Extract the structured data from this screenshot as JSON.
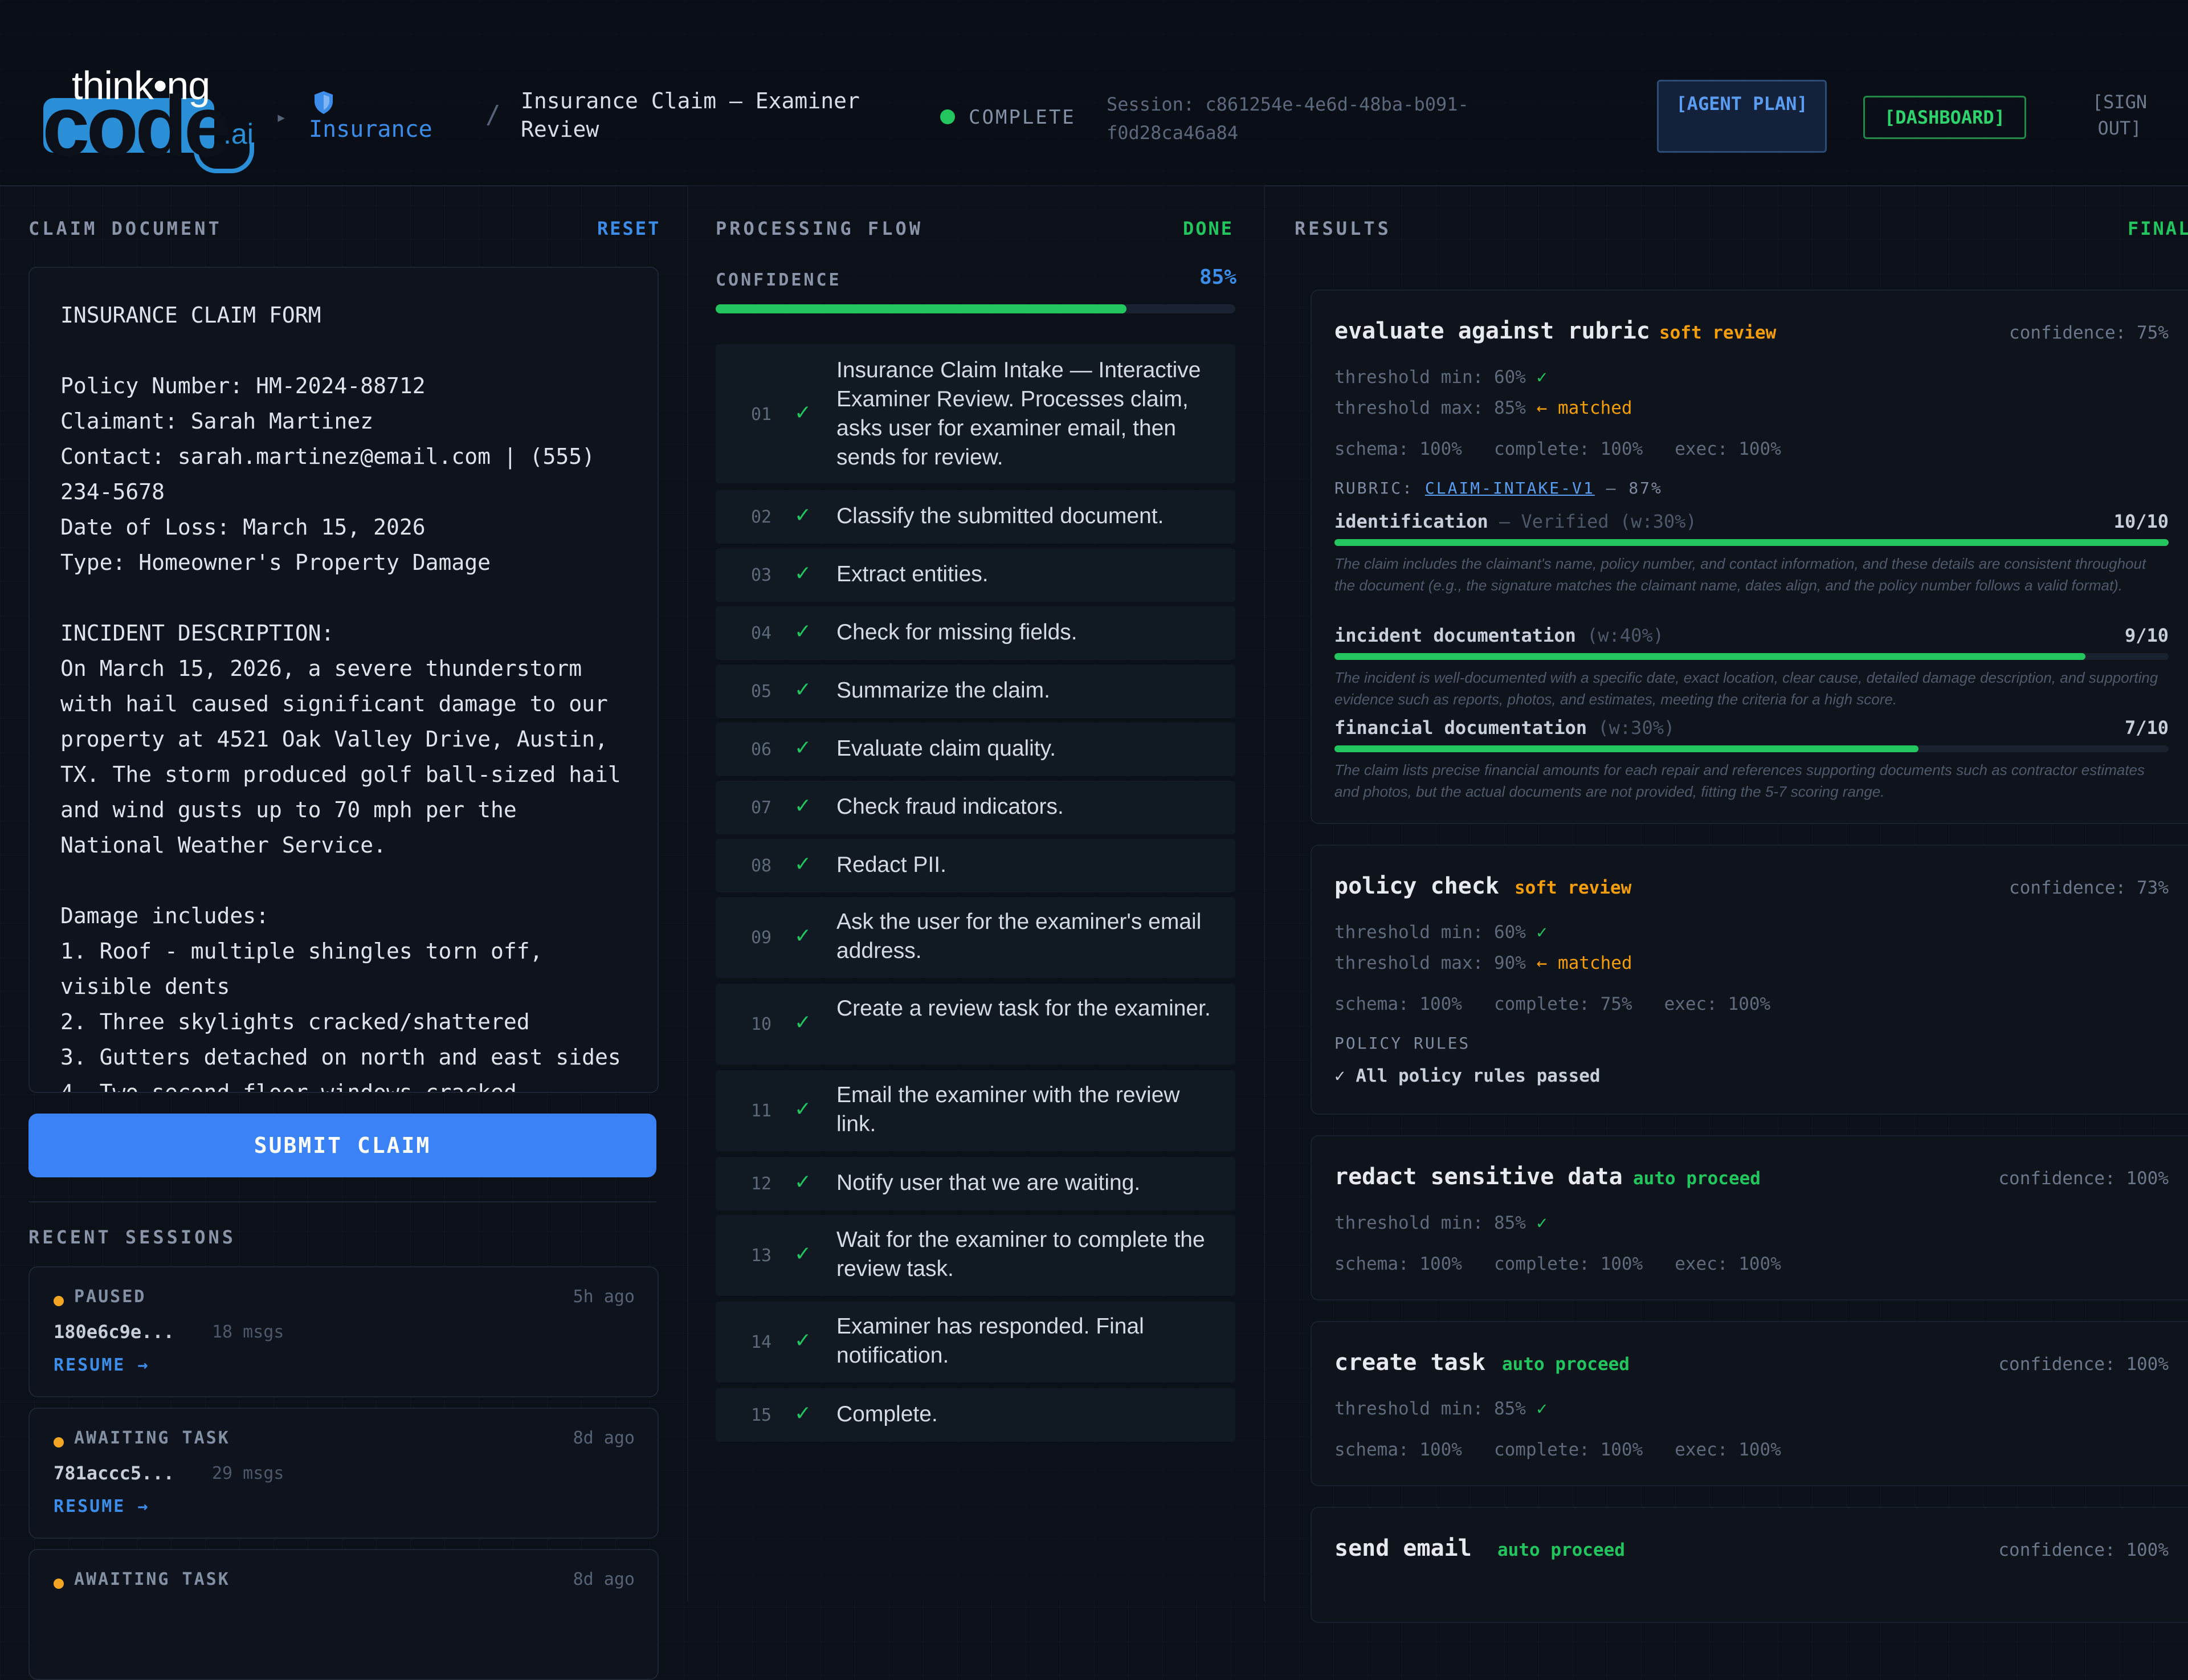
{
  "header": {
    "logo": {
      "line1": "think•ng",
      "line2": "code",
      "suffix": ".ai"
    },
    "breadcrumb_sep": "▸",
    "breadcrumb_section": "Insurance",
    "breadcrumb_divider": "/",
    "page_title": "Insurance Claim — Examiner Review",
    "status": "COMPLETE",
    "session": "Session: c861254e-4e6d-48ba-b091-f0d28ca46a84",
    "buttons": {
      "agent_plan": "[AGENT PLAN]",
      "dashboard": "[DASHBOARD]",
      "sign_out": "[SIGN OUT]"
    },
    "status_color": "#22c55e"
  },
  "left": {
    "title": "CLAIM DOCUMENT",
    "reset": "RESET",
    "claim_text": "INSURANCE CLAIM FORM\n\nPolicy Number: HM-2024-88712\nClaimant: Sarah Martinez\nContact: sarah.martinez@email.com | (555)\n234-5678\nDate of Loss: March 15, 2026\nType: Homeowner's Property Damage\n\nINCIDENT DESCRIPTION:\nOn March 15, 2026, a severe thunderstorm\nwith hail caused significant damage to our\nproperty at 4521 Oak Valley Drive, Austin,\nTX. The storm produced golf ball-sized hail\nand wind gusts up to 70 mph per the\nNational Weather Service.\n\nDamage includes:\n1. Roof - multiple shingles torn off,\nvisible dents\n2. Three skylights cracked/shattered\n3. Gutters detached on north and east sides\n4. Two second-floor windows cracked",
    "submit": "SUBMIT CLAIM",
    "recent_title": "RECENT SESSIONS",
    "sessions": [
      {
        "status": "PAUSED",
        "ago": "5h ago",
        "id": "180e6c9e...",
        "msgs": "18 msgs",
        "resume": "RESUME →"
      },
      {
        "status": "AWAITING TASK",
        "ago": "8d ago",
        "id": "781accc5...",
        "msgs": "29 msgs",
        "resume": "RESUME →"
      },
      {
        "status": "AWAITING TASK",
        "ago": "8d ago",
        "id": "",
        "msgs": "",
        "resume": ""
      }
    ]
  },
  "middle": {
    "title": "PROCESSING FLOW",
    "status": "DONE",
    "confidence_label": "CONFIDENCE",
    "confidence_value": "85%",
    "confidence_fraction": 0.85,
    "check": "✓",
    "steps": [
      {
        "num": "01",
        "text": "Insurance Claim Intake — Interactive Examiner Review. Processes claim, asks user for examiner email, then sends for review."
      },
      {
        "num": "02",
        "text": "Classify the submitted document."
      },
      {
        "num": "03",
        "text": "Extract entities."
      },
      {
        "num": "04",
        "text": "Check for missing fields."
      },
      {
        "num": "05",
        "text": "Summarize the claim."
      },
      {
        "num": "06",
        "text": "Evaluate claim quality."
      },
      {
        "num": "07",
        "text": "Check fraud indicators."
      },
      {
        "num": "08",
        "text": "Redact PII."
      },
      {
        "num": "09",
        "text": "Ask the user for the examiner's email address."
      },
      {
        "num": "10",
        "text": "Create a review task for the examiner."
      },
      {
        "num": "11",
        "text": "Email the examiner with the review link."
      },
      {
        "num": "12",
        "text": "Notify user that we are waiting."
      },
      {
        "num": "13",
        "text": "Wait for the examiner to complete the review task."
      },
      {
        "num": "14",
        "text": "Examiner has responded. Final notification."
      },
      {
        "num": "15",
        "text": "Complete."
      }
    ]
  },
  "results": {
    "title": "RESULTS",
    "status": "FINAL",
    "cards": [
      {
        "title": "evaluate against rubric",
        "badge": "soft review",
        "confidence": "confidence: 75%",
        "threshold_min": "threshold min: 60%",
        "threshold_min_mark": "✓",
        "threshold_max": "threshold max: 85%",
        "threshold_max_mark": "← matched",
        "metrics": "schema: 100%   complete: 100%   exec: 100%",
        "rubric_label": "RUBRIC:",
        "rubric_link": "CLAIM-INTAKE-V1",
        "rubric_score": "— 87%",
        "criteria": [
          {
            "name": "identification",
            "status": "— Verified",
            "weight": "(w:30%)",
            "score": "10/10",
            "fraction": 1.0,
            "desc": "The claim includes the claimant's name, policy number, and contact information, and these details are consistent throughout the document (e.g., the signature matches the claimant name, dates align, and the policy number follows a valid format)."
          },
          {
            "name": "incident documentation",
            "status": "",
            "weight": "(w:40%)",
            "score": "9/10",
            "fraction": 0.9,
            "desc": "The incident is well-documented with a specific date, exact location, clear cause, detailed damage description, and supporting evidence such as reports, photos, and estimates, meeting the criteria for a high score."
          },
          {
            "name": "financial documentation",
            "status": "",
            "weight": "(w:30%)",
            "score": "7/10",
            "fraction": 0.7,
            "desc": "The claim lists precise financial amounts for each repair and references supporting documents such as contractor estimates and photos, but the actual documents are not provided, fitting the 5-7 scoring range."
          }
        ]
      },
      {
        "title": "policy check",
        "badge": "soft review",
        "confidence": "confidence: 73%",
        "threshold_min": "threshold min: 60%",
        "threshold_min_mark": "✓",
        "threshold_max": "threshold max: 90%",
        "threshold_max_mark": "← matched",
        "metrics": "schema: 100%   complete: 75%   exec: 100%",
        "rules_label": "POLICY RULES",
        "rules_text": "✓ All policy rules passed"
      },
      {
        "title": "redact sensitive data",
        "badge": "auto proceed",
        "confidence": "confidence: 100%",
        "threshold_min": "threshold min: 85%",
        "threshold_min_mark": "✓",
        "metrics": "schema: 100%   complete: 100%   exec: 100%"
      },
      {
        "title": "create task",
        "badge": "auto proceed",
        "confidence": "confidence: 100%",
        "threshold_min": "threshold min: 85%",
        "threshold_min_mark": "✓",
        "metrics": "schema: 100%   complete: 100%   exec: 100%"
      },
      {
        "title": "send email",
        "badge": "auto proceed",
        "confidence": "confidence: 100%"
      }
    ]
  },
  "colors": {
    "accent": "#3b82f6",
    "success": "#22c55e",
    "warning": "#f59e0b",
    "link": "#3c8dea"
  }
}
